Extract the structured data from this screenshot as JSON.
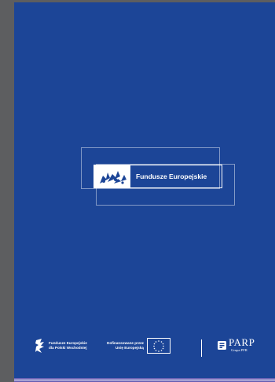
{
  "document": {
    "page_color": "#1c4597",
    "accent_stripe_color": "#6b63b5",
    "main_logo": {
      "icon": "fundusze-europejskie-star-icon",
      "text": "Fundusze Europejskie"
    },
    "footer": {
      "fe_logo_icon": "fundusze-europejskie-star-icon",
      "fe_line1": "Fundusze Europejskie",
      "fe_line2": "dla Polski Wschodniej",
      "eu_line1": "Dofinansowane przez",
      "eu_line2": "Unię Europejską",
      "eu_flag_icon": "eu-flag-icon",
      "parp_icon": "parp-icon",
      "parp_name": "PARP",
      "parp_sub": "Grupa PFR"
    }
  }
}
